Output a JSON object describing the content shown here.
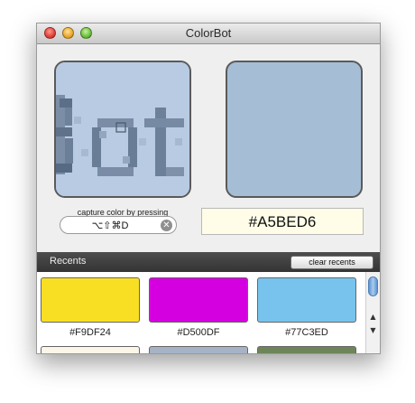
{
  "window": {
    "title": "ColorBot"
  },
  "picker": {
    "capture_label": "capture color by pressing",
    "shortcut": "⌥⇧⌘D",
    "current_hex": "#A5BED6",
    "current_color": "#A5BED6"
  },
  "recents": {
    "label": "Recents",
    "clear_label": "clear recents",
    "items": [
      {
        "hex": "#F9DF24",
        "color": "#F9DF24"
      },
      {
        "hex": "#D500DF",
        "color": "#D500DF"
      },
      {
        "hex": "#77C3ED",
        "color": "#77C3ED"
      },
      {
        "color": "#FBF6E8"
      },
      {
        "color": "#A6B3C6"
      },
      {
        "color": "#6E855A"
      }
    ]
  },
  "icons": {
    "close": "close-icon",
    "minimize": "minimize-icon",
    "zoom": "zoom-icon",
    "clear_field": "clear-field-icon",
    "scroll_up": "arrow-up-icon",
    "scroll_down": "arrow-down-icon"
  }
}
